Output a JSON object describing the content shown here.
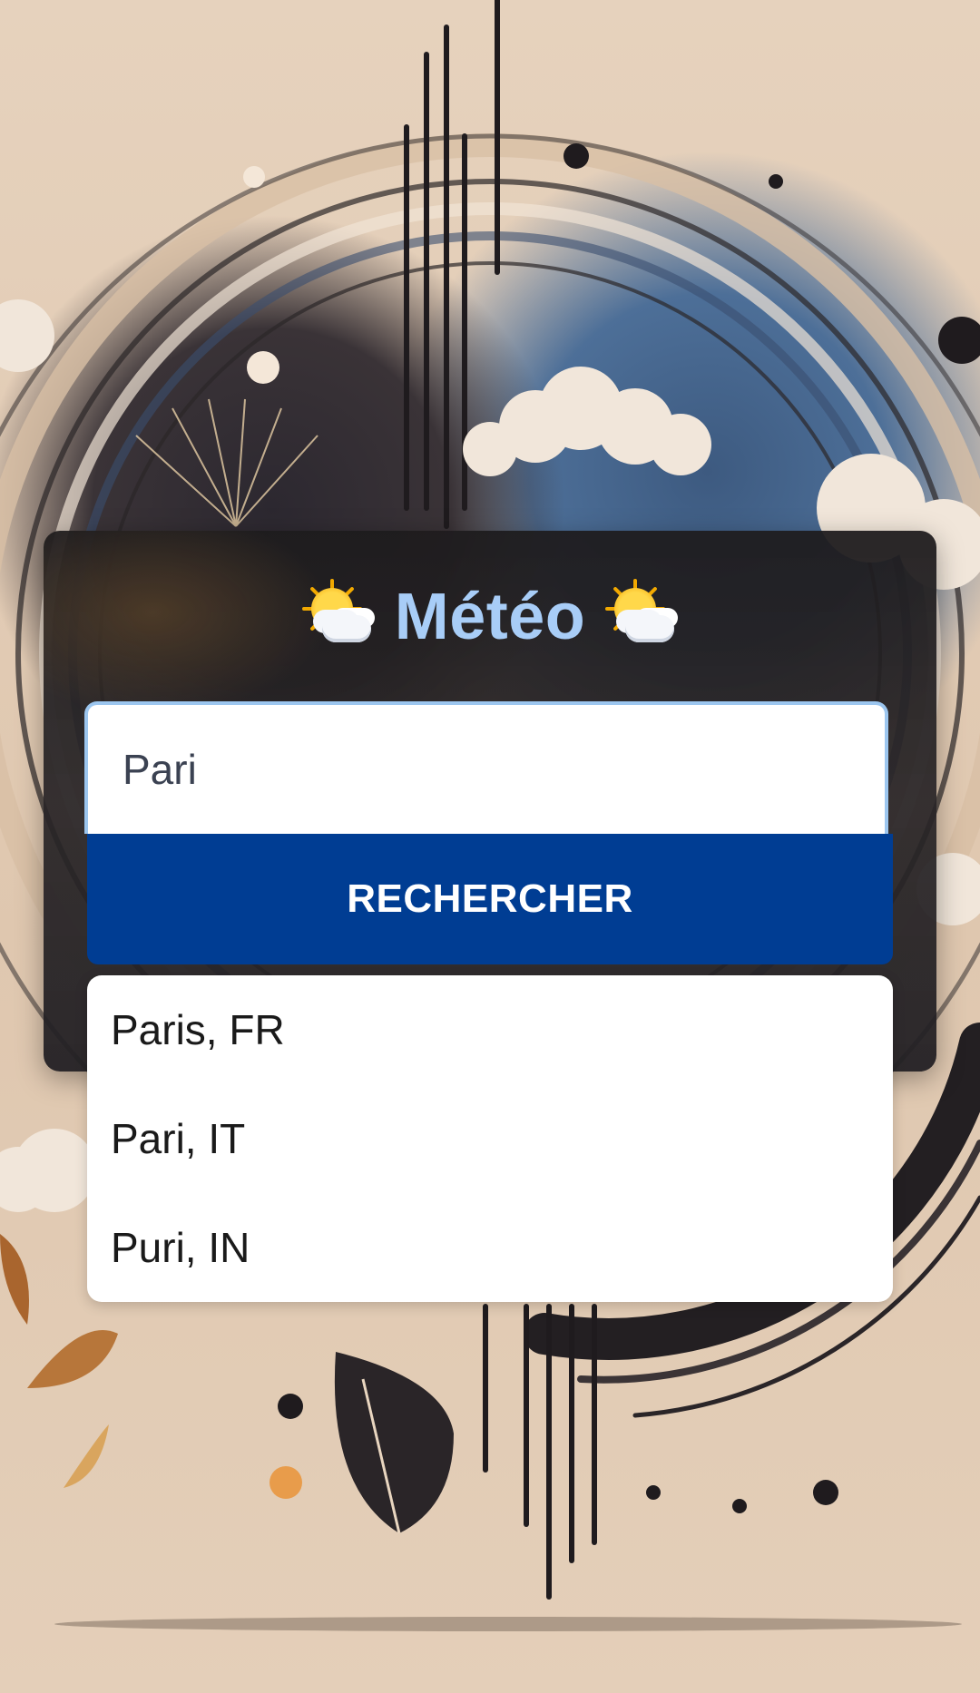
{
  "header": {
    "title": "Météo",
    "left_icon": "sun-behind-cloud-icon",
    "right_icon": "sun-behind-cloud-icon"
  },
  "search": {
    "value": "Pari",
    "button_label": "RECHERCHER"
  },
  "suggestions": [
    {
      "label": "Paris, FR"
    },
    {
      "label": "Pari, IT"
    },
    {
      "label": "Puri, IN"
    }
  ],
  "colors": {
    "title": "#a8cdf7",
    "button": "#003d93",
    "input_border": "#9cc6ef"
  }
}
